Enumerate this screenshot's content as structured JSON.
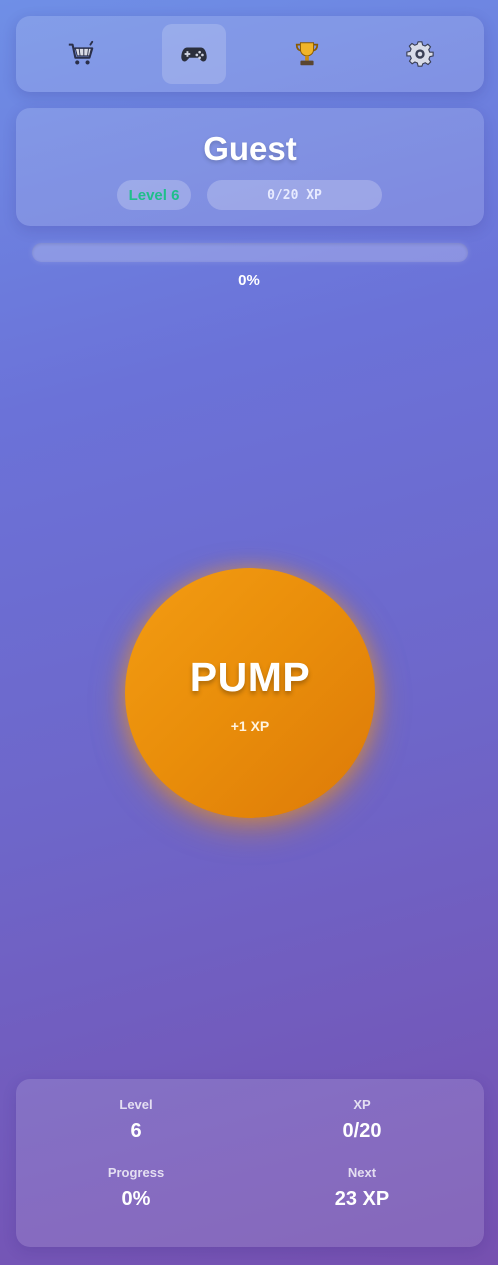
{
  "nav": {
    "items": [
      {
        "name": "shop",
        "icon": "shopping-cart-icon",
        "active": false
      },
      {
        "name": "game",
        "icon": "game-controller-icon",
        "active": true
      },
      {
        "name": "leaderboard",
        "icon": "trophy-icon",
        "active": false
      },
      {
        "name": "settings",
        "icon": "gear-icon",
        "active": false
      }
    ]
  },
  "profile": {
    "name": "Guest",
    "level_label": "Level 6",
    "xp_label": "0/20 XP"
  },
  "progress": {
    "value": 0,
    "label": "0%"
  },
  "pump": {
    "label": "PUMP",
    "reward": "+1 XP"
  },
  "stats": {
    "level": {
      "label": "Level",
      "value": "6"
    },
    "xp": {
      "label": "XP",
      "value": "0/20"
    },
    "progress": {
      "label": "Progress",
      "value": "0%"
    },
    "next": {
      "label": "Next",
      "value": "23 XP"
    }
  },
  "colors": {
    "accent": "#f39c12",
    "level_text": "#1fbf8a"
  }
}
